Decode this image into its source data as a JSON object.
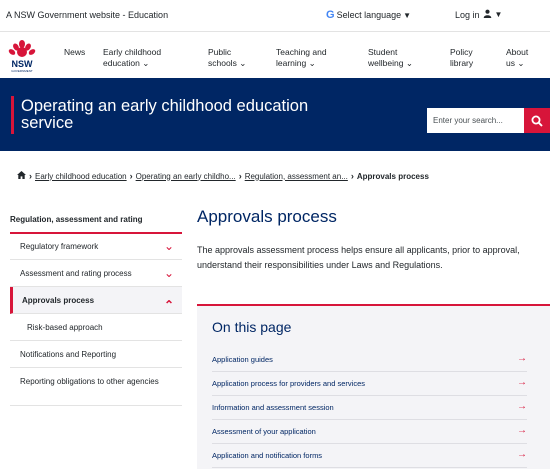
{
  "utility": {
    "gov_text": "A NSW Government website - Education",
    "language_label": "Select language",
    "login_label": "Log in"
  },
  "logo": {
    "wordmark": "NSW",
    "subtext": "GOVERNMENT"
  },
  "nav": [
    {
      "line1": "News",
      "line2": ""
    },
    {
      "line1": "Early childhood",
      "line2": "education"
    },
    {
      "line1": "Public",
      "line2": "schools"
    },
    {
      "line1": "Teaching and",
      "line2": "learning"
    },
    {
      "line1": "Student",
      "line2": "wellbeing"
    },
    {
      "line1": "Policy",
      "line2": "library"
    },
    {
      "line1": "About",
      "line2": "us"
    }
  ],
  "hero": {
    "title": "Operating an early childhood education service",
    "search_placeholder": "Enter your search..."
  },
  "breadcrumb": {
    "items": [
      "Early childhood education",
      "Operating an early childho...",
      "Regulation, assessment an..."
    ],
    "current": "Approvals process"
  },
  "sidenav": {
    "title": "Regulation, assessment and rating",
    "items": [
      {
        "label": "Regulatory framework",
        "chevron": "⌄"
      },
      {
        "label": "Assessment and rating process",
        "chevron": "⌄"
      },
      {
        "label": "Approvals process",
        "chevron": "⌃"
      },
      {
        "label": "Risk-based approach",
        "chevron": ""
      },
      {
        "label": "Notifications and Reporting",
        "chevron": ""
      },
      {
        "label": "Reporting obligations to other agencies",
        "chevron": ""
      }
    ]
  },
  "content": {
    "title": "Approvals process",
    "intro": "The approvals assessment process helps ensure all applicants, prior to approval, understand their responsibilities under Laws and Regulations.",
    "on_this_page": {
      "heading": "On this page",
      "links": [
        "Application guides",
        "Application process for providers and services",
        "Information and assessment session",
        "Assessment of your application",
        "Application and notification forms"
      ],
      "arrow": "→"
    }
  },
  "colors": {
    "navy": "#002664",
    "red": "#d7153a",
    "light_bg": "#f4f4f7"
  },
  "icons": [
    "google-g-icon",
    "user-icon",
    "waratah-logo",
    "search-icon",
    "home-icon",
    "chevron-down-icon",
    "chevron-up-icon",
    "arrow-right-icon"
  ]
}
